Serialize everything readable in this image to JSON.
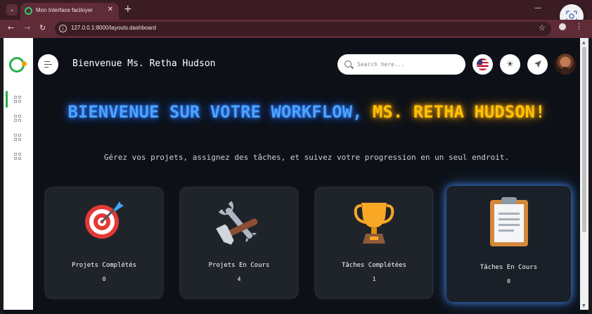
{
  "browser": {
    "tab_title": "Mon Interface faciloyer",
    "url": "127.0.0.1:8000/layouts.dashboard"
  },
  "header": {
    "welcome": "Bienvenue Ms. Retha Hudson",
    "search_placeholder": "Search here..."
  },
  "hero": {
    "title_main": "BIENVENUE SUR VOTRE WORKFLOW, ",
    "title_name": "MS. RETHA HUDSON",
    "title_end": "!",
    "subtitle": "Gérez vos projets, assignez des tâches, et suivez votre progression en un seul endroit."
  },
  "cards": [
    {
      "label": "Projets Complétés",
      "value": "0",
      "icon": "target-dart-icon"
    },
    {
      "label": "Projets En Cours",
      "value": "4",
      "icon": "tools-icon"
    },
    {
      "label": "Tâches Complétées",
      "value": "1",
      "icon": "trophy-icon"
    },
    {
      "label": "Tâches En Cours",
      "value": "0",
      "icon": "clipboard-icon"
    }
  ],
  "colors": {
    "accent_blue": "#4da3ff",
    "accent_gold": "#ffc107",
    "brand_green": "#22b14c",
    "page_bg": "#0d1117"
  }
}
